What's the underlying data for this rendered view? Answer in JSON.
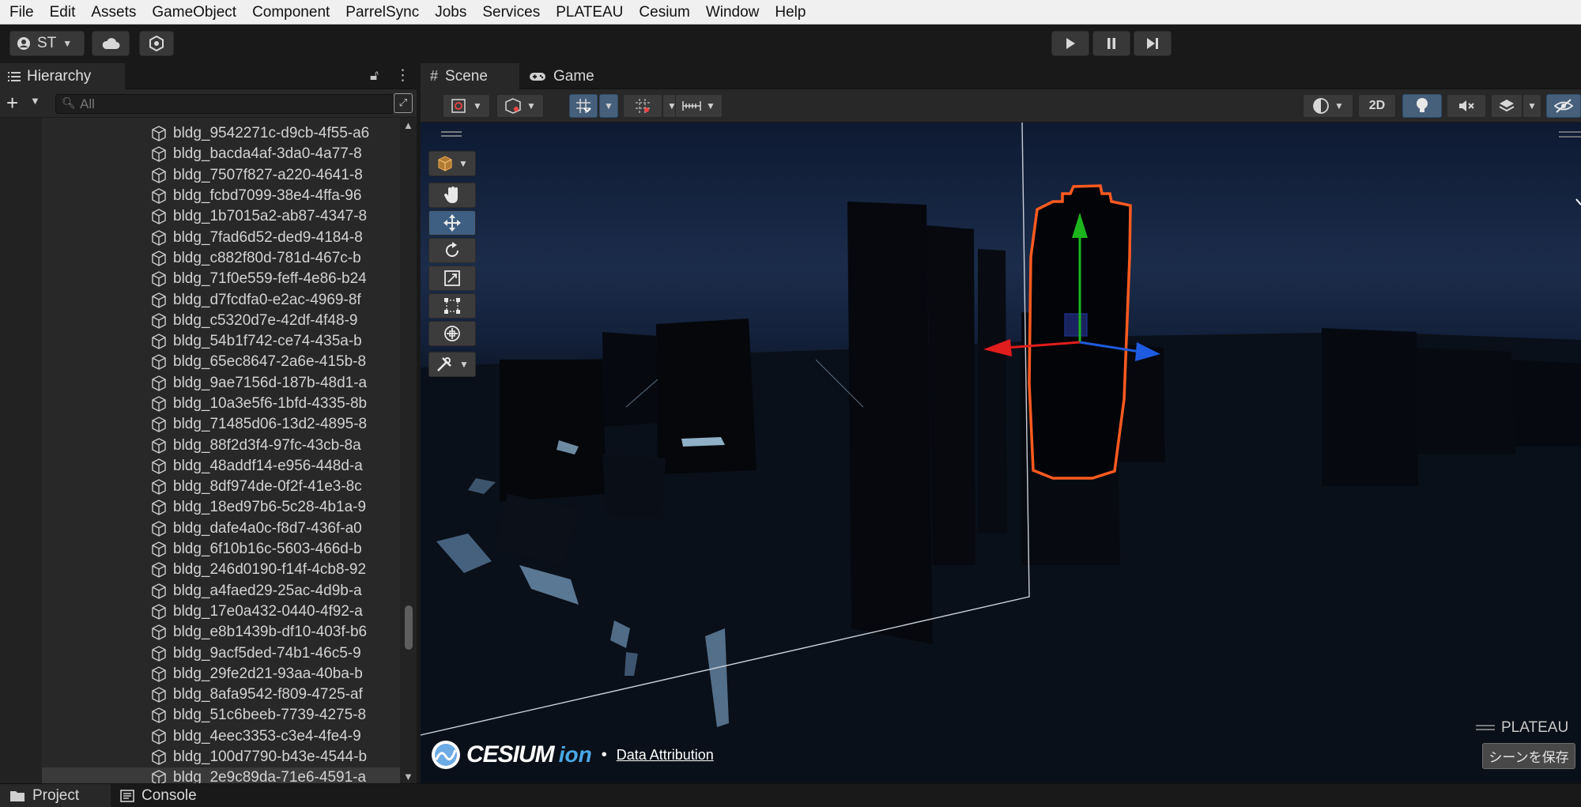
{
  "menu": [
    "File",
    "Edit",
    "Assets",
    "GameObject",
    "Component",
    "ParrelSync",
    "Jobs",
    "Services",
    "PLATEAU",
    "Cesium",
    "Window",
    "Help"
  ],
  "toolbar": {
    "account_label": "ST"
  },
  "hierarchy": {
    "tab_label": "Hierarchy",
    "search_placeholder": "All",
    "items": [
      "bldg_9542271c-d9cb-4f55-a6",
      "bldg_bacda4af-3da0-4a77-8",
      "bldg_7507f827-a220-4641-8",
      "bldg_fcbd7099-38e4-4ffa-96",
      "bldg_1b7015a2-ab87-4347-8",
      "bldg_7fad6d52-ded9-4184-8",
      "bldg_c882f80d-781d-467c-b",
      "bldg_71f0e559-feff-4e86-b24",
      "bldg_d7fcdfa0-e2ac-4969-8f",
      "bldg_c5320d7e-42df-4f48-9",
      "bldg_54b1f742-ce74-435a-b",
      "bldg_65ec8647-2a6e-415b-8",
      "bldg_9ae7156d-187b-48d1-a",
      "bldg_10a3e5f6-1bfd-4335-8b",
      "bldg_71485d06-13d2-4895-8",
      "bldg_88f2d3f4-97fc-43cb-8a",
      "bldg_48addf14-e956-448d-a",
      "bldg_8df974de-0f2f-41e3-8c",
      "bldg_18ed97b6-5c28-4b1a-9",
      "bldg_dafe4a0c-f8d7-436f-a0",
      "bldg_6f10b16c-5603-466d-b",
      "bldg_246d0190-f14f-4cb8-92",
      "bldg_a4faed29-25ac-4d9b-a",
      "bldg_17e0a432-0440-4f92-a",
      "bldg_e8b1439b-df10-403f-b6",
      "bldg_9acf5ded-74b1-46c5-9",
      "bldg_29fe2d21-93aa-40ba-b",
      "bldg_8afa9542-f809-4725-af",
      "bldg_51c6beeb-7739-4275-8",
      "bldg_4eec3353-c3e4-4fe4-9",
      "bldg_100d7790-b43e-4544-b",
      "bldg_2e9c89da-71e6-4591-a"
    ]
  },
  "scene": {
    "tabs": {
      "scene": "Scene",
      "game": "Game"
    },
    "toggle_2d": "2D",
    "cesium_brand": "CESIUM",
    "cesium_ion": "ion",
    "bullet": "•",
    "data_attribution": "Data Attribution",
    "plateau_label": "PLATEAU",
    "save_scene": "シーンを保存"
  },
  "bottom_tabs": {
    "project": "Project",
    "console": "Console"
  },
  "colors": {
    "accent_blue": "#3e5f82",
    "selection_orange": "#ff5a1f",
    "axis_x": "#e11d1d",
    "axis_y": "#1db51d",
    "axis_z": "#1f5be0"
  }
}
